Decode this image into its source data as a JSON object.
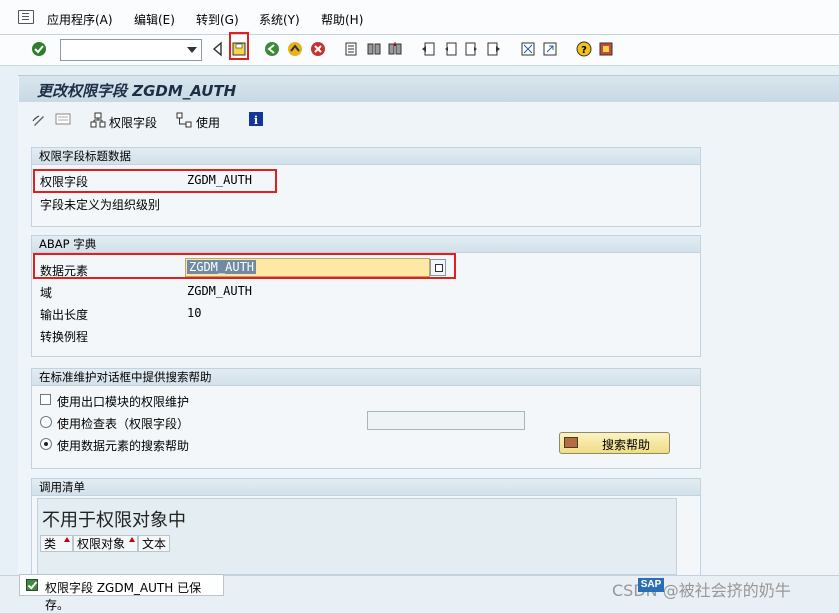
{
  "menu": {
    "items": [
      "应用程序(A)",
      "编辑(E)",
      "转到(G)",
      "系统(Y)",
      "帮助(H)"
    ]
  },
  "toolbar": {
    "icons": [
      "enter-icon",
      "command-field",
      "back-nav-icon",
      "save-icon",
      "back-icon",
      "exit-icon",
      "cancel-icon",
      "print-icon",
      "find-icon",
      "find-next-icon",
      "first-page-icon",
      "prev-page-icon",
      "next-page-icon",
      "last-page-icon",
      "create-session-icon",
      "shortcut-icon",
      "help-icon",
      "layout-icon"
    ]
  },
  "page": {
    "title": "更改权限字段 ZGDM_AUTH"
  },
  "app_toolbar": {
    "auth_field_label": "权限字段",
    "usage_label": "使用"
  },
  "header_group": {
    "title": "权限字段标题数据",
    "field_label": "权限字段",
    "field_value": "ZGDM_AUTH",
    "note": "字段未定义为组织级别"
  },
  "abap_group": {
    "title": "ABAP 字典",
    "data_element_label": "数据元素",
    "data_element_value": "ZGDM_AUTH",
    "domain_label": "域",
    "domain_value": "ZGDM_AUTH",
    "output_length_label": "输出长度",
    "output_length_value": "10",
    "conversion_label": "转换例程",
    "conversion_value": ""
  },
  "search_help_group": {
    "title": "在标准维护对话框中提供搜索帮助",
    "exit_module_label": "使用出口模块的权限维护",
    "check_table_label": "使用检查表（权限字段）",
    "data_element_help_label": "使用数据元素的搜索帮助",
    "search_help_button": "搜索帮助"
  },
  "where_used": {
    "title": "调用清单",
    "table_title": "不用于权限对象中",
    "columns": [
      "类",
      "权限对象",
      "文本"
    ]
  },
  "status": {
    "message": "权限字段 ZGDM_AUTH 已保存。"
  },
  "watermark": {
    "text": "CSDN @被社会挤的奶牛"
  },
  "colors": {
    "highlight_red": "#e0201e",
    "field_yellow": "#fde8a6",
    "background": "#e8f0f7"
  }
}
